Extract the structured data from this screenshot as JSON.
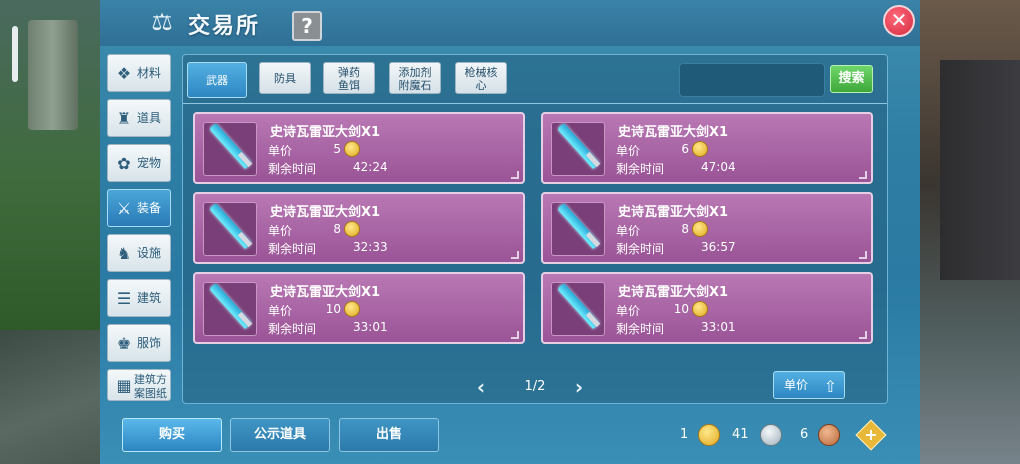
{
  "window": {
    "title": "交易所",
    "help_label": "?",
    "close_label": "✕"
  },
  "sidebar": {
    "items": [
      {
        "label": "材料",
        "icon": "ore-icon"
      },
      {
        "label": "道具",
        "icon": "potion-icon"
      },
      {
        "label": "宠物",
        "icon": "paw-icon"
      },
      {
        "label": "装备",
        "icon": "equip-icon",
        "active": true
      },
      {
        "label": "设施",
        "icon": "facility-icon"
      },
      {
        "label": "建筑",
        "icon": "building-icon"
      },
      {
        "label": "服饰",
        "icon": "clothing-icon"
      },
      {
        "label": "建筑方案图纸",
        "icon": "blueprint-icon"
      }
    ]
  },
  "tabs": [
    {
      "label": "武器",
      "active": true
    },
    {
      "label": "防具"
    },
    {
      "label": "弹药\n鱼饵"
    },
    {
      "label": "添加剂\n附魔石"
    },
    {
      "label": "枪械核\n心"
    }
  ],
  "search": {
    "placeholder": "",
    "button_label": "搜索"
  },
  "listings_labels": {
    "price": "单价",
    "time": "剩余时间"
  },
  "listings": [
    {
      "name": "史诗瓦雷亚大剑X1",
      "price": "5",
      "time": "42:24"
    },
    {
      "name": "史诗瓦雷亚大剑X1",
      "price": "6",
      "time": "47:04"
    },
    {
      "name": "史诗瓦雷亚大剑X1",
      "price": "8",
      "time": "32:33"
    },
    {
      "name": "史诗瓦雷亚大剑X1",
      "price": "8",
      "time": "36:57"
    },
    {
      "name": "史诗瓦雷亚大剑X1",
      "price": "10",
      "time": "33:01"
    },
    {
      "name": "史诗瓦雷亚大剑X1",
      "price": "10",
      "time": "33:01"
    }
  ],
  "pagination": {
    "prev": "‹",
    "next": "›",
    "page": "1/2"
  },
  "sort": {
    "label": "单价"
  },
  "bottom": {
    "buy": "购买",
    "public": "公示道具",
    "sell": "出售"
  },
  "currency": {
    "gold": "1",
    "silver": "41",
    "copper": "6",
    "add_label": "+"
  }
}
